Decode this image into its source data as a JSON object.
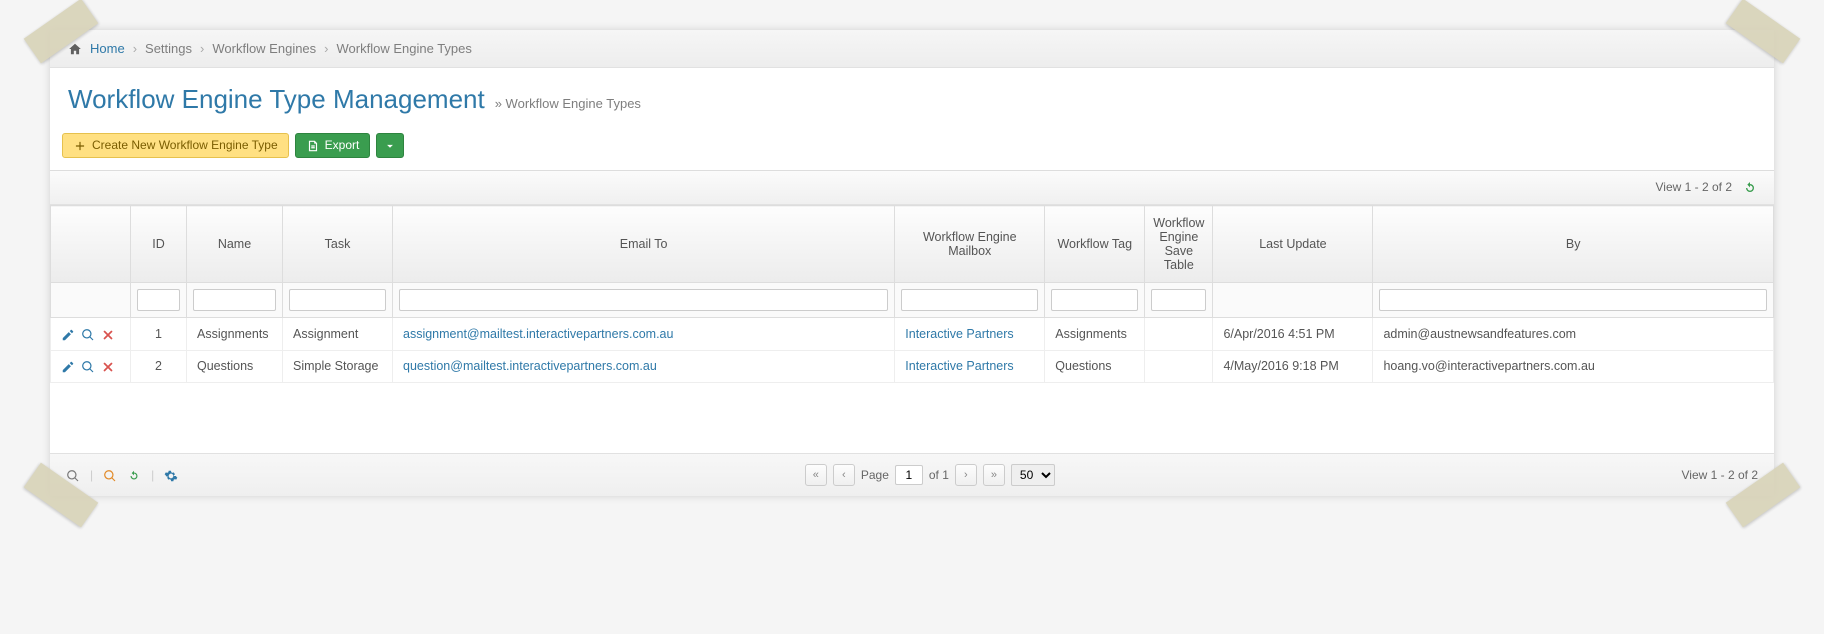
{
  "breadcrumb": {
    "home": "Home",
    "settings": "Settings",
    "engines": "Workflow Engines",
    "types": "Workflow Engine Types"
  },
  "header": {
    "title": "Workflow Engine Type Management",
    "subpath": "» Workflow Engine Types"
  },
  "toolbar": {
    "create_label": "Create New Workflow Engine Type",
    "export_label": "Export"
  },
  "info": {
    "view_range_top": "View 1 - 2 of 2",
    "view_range_bottom": "View 1 - 2 of 2"
  },
  "columns": {
    "id": "ID",
    "name": "Name",
    "task": "Task",
    "email_to": "Email To",
    "mailbox": "Workflow Engine Mailbox",
    "tag": "Workflow Tag",
    "save_table": "Workflow Engine Save Table",
    "last_update": "Last Update",
    "by": "By"
  },
  "rows": [
    {
      "id": "1",
      "name": "Assignments",
      "task": "Assignment",
      "email_to": "assignment@mailtest.interactivepartners.com.au",
      "mailbox": "Interactive Partners",
      "tag": "Assignments",
      "save_table": "",
      "last_update": "6/Apr/2016 4:51 PM",
      "by": "admin@austnewsandfeatures.com"
    },
    {
      "id": "2",
      "name": "Questions",
      "task": "Simple Storage",
      "email_to": "question@mailtest.interactivepartners.com.au",
      "mailbox": "Interactive Partners",
      "tag": "Questions",
      "save_table": "",
      "last_update": "4/May/2016 9:18 PM",
      "by": "hoang.vo@interactivepartners.com.au"
    }
  ],
  "pager": {
    "page_label": "Page",
    "page_value": "1",
    "of_label": "of 1",
    "page_size": "50"
  }
}
